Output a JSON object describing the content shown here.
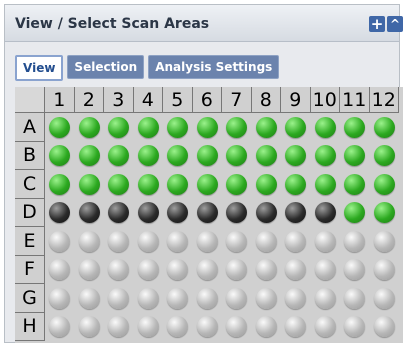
{
  "panel": {
    "title": "View / Select Scan Areas",
    "plus_icon": "+",
    "collapse_icon": "^"
  },
  "tabs": [
    {
      "label": "View",
      "active": true
    },
    {
      "label": "Selection",
      "active": false
    },
    {
      "label": "Analysis Settings",
      "active": false
    }
  ],
  "plate": {
    "columns": [
      "1",
      "2",
      "3",
      "4",
      "5",
      "6",
      "7",
      "8",
      "9",
      "10",
      "11",
      "12"
    ],
    "rows": [
      "A",
      "B",
      "C",
      "D",
      "E",
      "F",
      "G",
      "H"
    ],
    "well_colors": {
      "green": "#2ca920",
      "black": "#2b2b2b",
      "gray": "#b7b7b7"
    },
    "wells": [
      [
        "green",
        "green",
        "green",
        "green",
        "green",
        "green",
        "green",
        "green",
        "green",
        "green",
        "green",
        "green"
      ],
      [
        "green",
        "green",
        "green",
        "green",
        "green",
        "green",
        "green",
        "green",
        "green",
        "green",
        "green",
        "green"
      ],
      [
        "green",
        "green",
        "green",
        "green",
        "green",
        "green",
        "green",
        "green",
        "green",
        "green",
        "green",
        "green"
      ],
      [
        "black",
        "black",
        "black",
        "black",
        "black",
        "black",
        "black",
        "black",
        "black",
        "black",
        "green",
        "green"
      ],
      [
        "gray",
        "gray",
        "gray",
        "gray",
        "gray",
        "gray",
        "gray",
        "gray",
        "gray",
        "gray",
        "gray",
        "gray"
      ],
      [
        "gray",
        "gray",
        "gray",
        "gray",
        "gray",
        "gray",
        "gray",
        "gray",
        "gray",
        "gray",
        "gray",
        "gray"
      ],
      [
        "gray",
        "gray",
        "gray",
        "gray",
        "gray",
        "gray",
        "gray",
        "gray",
        "gray",
        "gray",
        "gray",
        "gray"
      ],
      [
        "gray",
        "gray",
        "gray",
        "gray",
        "gray",
        "gray",
        "gray",
        "gray",
        "gray",
        "gray",
        "gray",
        "gray"
      ]
    ]
  }
}
